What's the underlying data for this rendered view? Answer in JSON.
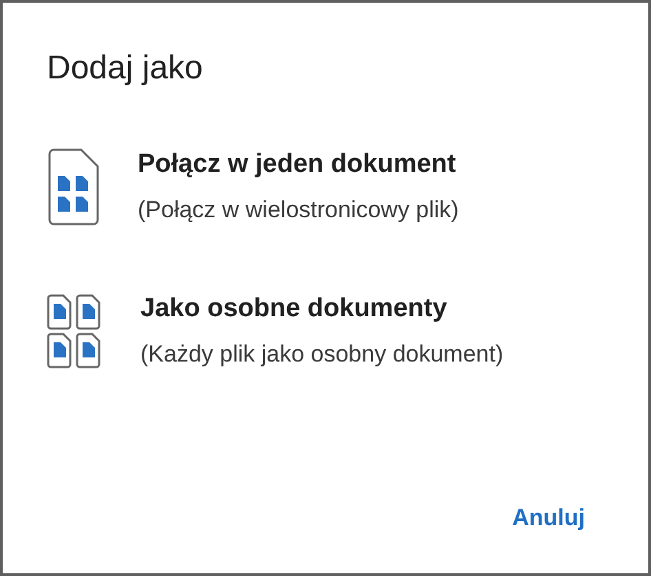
{
  "dialog": {
    "title": "Dodaj jako",
    "options": [
      {
        "kind": "merge",
        "label": "Połącz w jeden dokument",
        "description": "(Połącz w wielostronicowy plik)"
      },
      {
        "kind": "separate",
        "label": "Jako osobne dokumenty",
        "description": "(Każdy plik jako osobny dokument)"
      }
    ],
    "buttons": [
      "Anuluj"
    ]
  }
}
